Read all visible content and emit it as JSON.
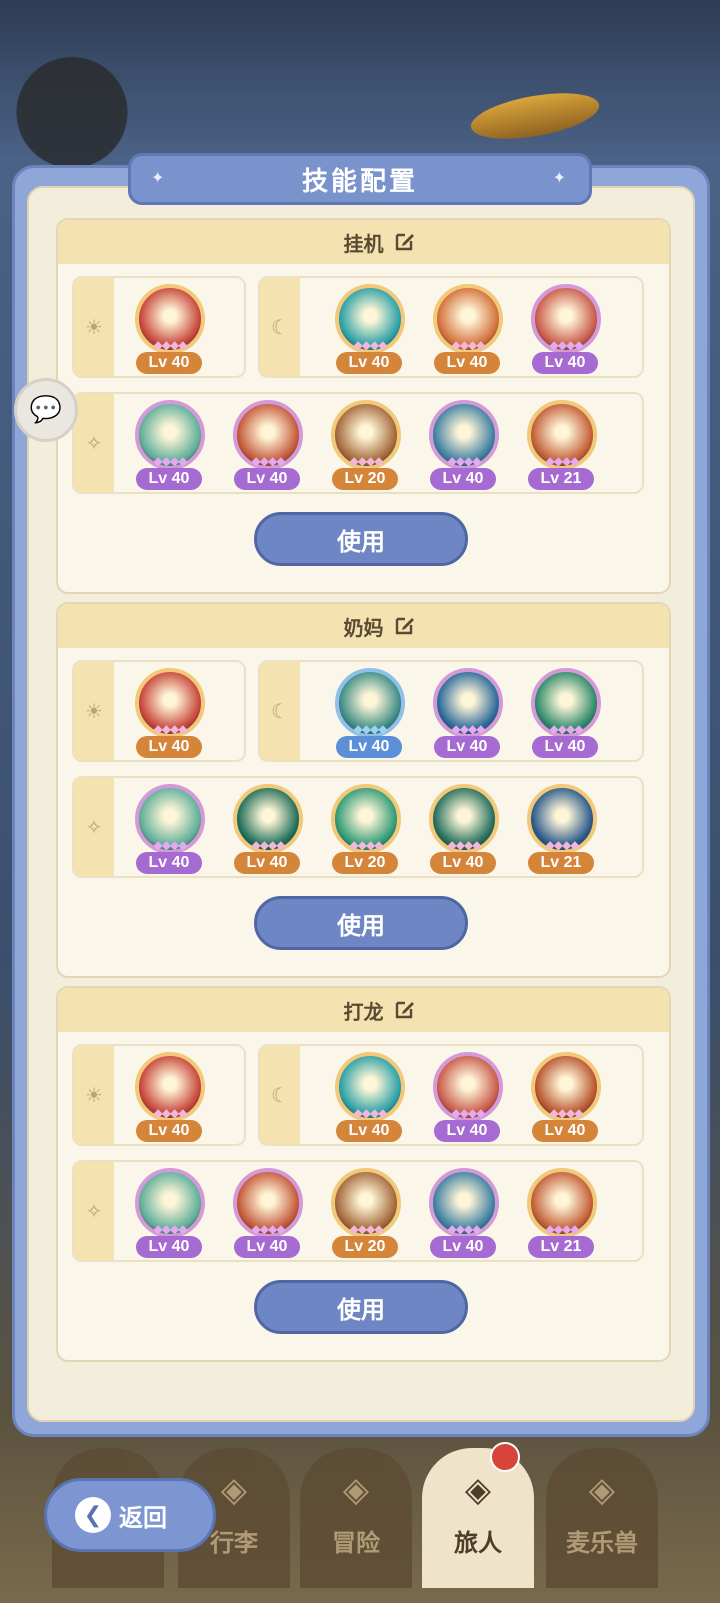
{
  "header": {
    "title": "技能配置"
  },
  "lv_colors": {
    "orange": "#d4853a",
    "purple": "#a66bd3",
    "blue": "#5b8fd8"
  },
  "configs": [
    {
      "name": "挂机",
      "use_label": "使用",
      "rows": [
        {
          "side": "sun",
          "skills": [
            {
              "level": "Lv 40",
              "tier": "orange",
              "ring": "orange",
              "art": "#c6453a"
            }
          ]
        },
        {
          "side": "moon",
          "skills": [
            {
              "level": "Lv 40",
              "tier": "orange",
              "ring": "orange",
              "art": "#2aa0a6"
            },
            {
              "level": "Lv 40",
              "tier": "orange",
              "ring": "orange",
              "art": "#d2703a"
            },
            {
              "level": "Lv 40",
              "tier": "purple",
              "ring": "purple",
              "art": "#c85a4a"
            }
          ]
        },
        {
          "side": "star",
          "skills": [
            {
              "level": "Lv 40",
              "tier": "purple",
              "ring": "purple",
              "art": "#5fae9a"
            },
            {
              "level": "Lv 40",
              "tier": "purple",
              "ring": "purple",
              "art": "#c4583a"
            },
            {
              "level": "Lv 20",
              "tier": "orange",
              "ring": "orange",
              "art": "#a3683a"
            },
            {
              "level": "Lv 40",
              "tier": "purple",
              "ring": "purple",
              "art": "#3e7fa0"
            },
            {
              "level": "Lv 21",
              "tier": "purple",
              "ring": "orange",
              "art": "#c25e36"
            }
          ]
        }
      ]
    },
    {
      "name": "奶妈",
      "use_label": "使用",
      "rows": [
        {
          "side": "sun",
          "skills": [
            {
              "level": "Lv 40",
              "tier": "orange",
              "ring": "orange",
              "art": "#c6453a"
            }
          ]
        },
        {
          "side": "moon",
          "skills": [
            {
              "level": "Lv 40",
              "tier": "blue",
              "ring": "blue",
              "art": "#3d8c86"
            },
            {
              "level": "Lv 40",
              "tier": "purple",
              "ring": "purple",
              "art": "#2b6a9a"
            },
            {
              "level": "Lv 40",
              "tier": "purple",
              "ring": "purple",
              "art": "#2d8a6a"
            }
          ]
        },
        {
          "side": "star",
          "skills": [
            {
              "level": "Lv 40",
              "tier": "purple",
              "ring": "purple",
              "art": "#5fae9a"
            },
            {
              "level": "Lv 40",
              "tier": "orange",
              "ring": "orange",
              "art": "#1f6e5a"
            },
            {
              "level": "Lv 20",
              "tier": "orange",
              "ring": "orange",
              "art": "#2f9a76"
            },
            {
              "level": "Lv 40",
              "tier": "orange",
              "ring": "orange",
              "art": "#236e5c"
            },
            {
              "level": "Lv 21",
              "tier": "orange",
              "ring": "orange",
              "art": "#2a5a8a"
            }
          ]
        }
      ]
    },
    {
      "name": "打龙",
      "use_label": "使用",
      "rows": [
        {
          "side": "sun",
          "skills": [
            {
              "level": "Lv 40",
              "tier": "orange",
              "ring": "orange",
              "art": "#c6453a"
            }
          ]
        },
        {
          "side": "moon",
          "skills": [
            {
              "level": "Lv 40",
              "tier": "orange",
              "ring": "orange",
              "art": "#2aa0a6"
            },
            {
              "level": "Lv 40",
              "tier": "purple",
              "ring": "purple",
              "art": "#c85a4a"
            },
            {
              "level": "Lv 40",
              "tier": "orange",
              "ring": "orange",
              "art": "#b8552e"
            }
          ]
        },
        {
          "side": "star",
          "skills": [
            {
              "level": "Lv 40",
              "tier": "purple",
              "ring": "purple",
              "art": "#5fae9a"
            },
            {
              "level": "Lv 40",
              "tier": "purple",
              "ring": "purple",
              "art": "#c4583a"
            },
            {
              "level": "Lv 20",
              "tier": "orange",
              "ring": "orange",
              "art": "#a3683a"
            },
            {
              "level": "Lv 40",
              "tier": "purple",
              "ring": "purple",
              "art": "#3e7fa0"
            },
            {
              "level": "Lv 21",
              "tier": "purple",
              "ring": "orange",
              "art": "#c25e36"
            }
          ]
        }
      ]
    }
  ],
  "nav": [
    {
      "label": "",
      "icon": "castle-icon"
    },
    {
      "label": "行李",
      "icon": "luggage-icon"
    },
    {
      "label": "冒险",
      "icon": "swords-icon"
    },
    {
      "label": "旅人",
      "icon": "traveler-icon",
      "active": true,
      "badge": true
    },
    {
      "label": "麦乐兽",
      "icon": "pet-icon"
    }
  ],
  "back_label": "返回",
  "side_icons": {
    "sun": "☀",
    "moon": "☾",
    "star": "✧"
  }
}
